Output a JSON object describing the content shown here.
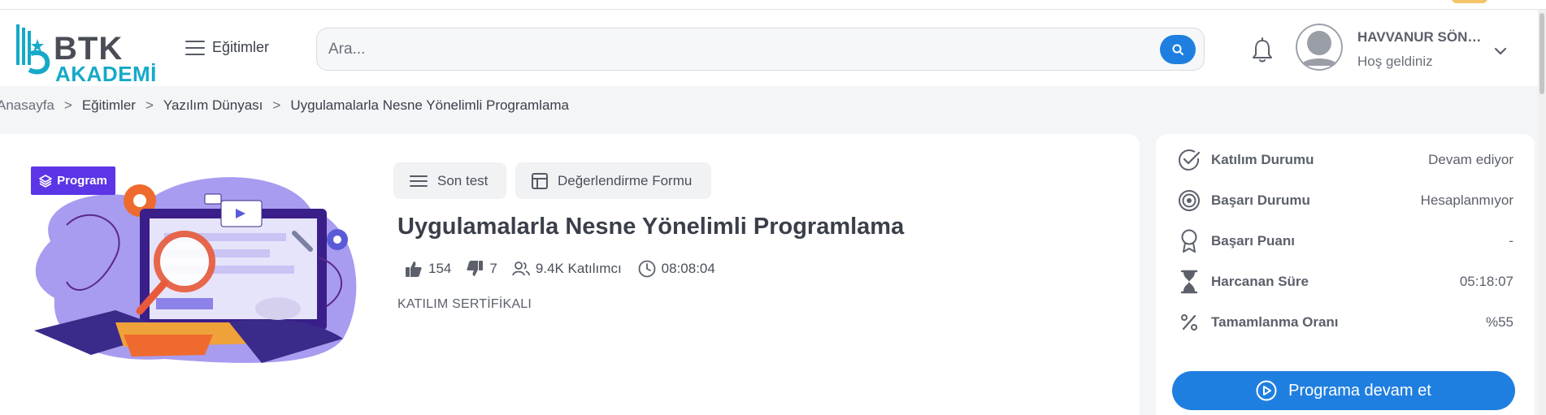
{
  "brand": {
    "logo_line1": "BTK",
    "logo_line2": "AKADEMİ",
    "color_primary": "#1f7fe0",
    "color_logo_teal": "#16a9c9",
    "color_badge": "#5b35e6"
  },
  "header": {
    "menu_label": "Eğitimler",
    "search_placeholder": "Ara...",
    "user_name": "HAVVANUR SÖNMEZ",
    "user_greeting": "Hoş geldiniz"
  },
  "breadcrumb": {
    "items": [
      "Anasayfa",
      "Eğitimler",
      "Yazılım Dünyası"
    ],
    "separator": ">",
    "current": "Uygulamalarla Nesne Yönelimli Programlama"
  },
  "course": {
    "badge": "Program",
    "actions": {
      "final_test": "Son test",
      "evaluation_form": "Değerlendirme Formu"
    },
    "title": "Uygulamalarla Nesne Yönelimli Programlama",
    "likes": "154",
    "dislikes": "7",
    "participants": "9.4K Katılımcı",
    "duration": "08:08:04",
    "certificate": "KATILIM SERTİFİKALI"
  },
  "status_panel": {
    "rows": [
      {
        "icon": "check-circle-icon",
        "label": "Katılım Durumu",
        "value": "Devam ediyor"
      },
      {
        "icon": "target-icon",
        "label": "Başarı Durumu",
        "value": "Hesaplanmıyor"
      },
      {
        "icon": "award-icon",
        "label": "Başarı Puanı",
        "value": "-"
      },
      {
        "icon": "hourglass-icon",
        "label": "Harcanan Süre",
        "value": "05:18:07"
      },
      {
        "icon": "percent-icon",
        "label": "Tamamlanma Oranı",
        "value": "%55"
      }
    ],
    "continue_label": "Programa devam et"
  }
}
